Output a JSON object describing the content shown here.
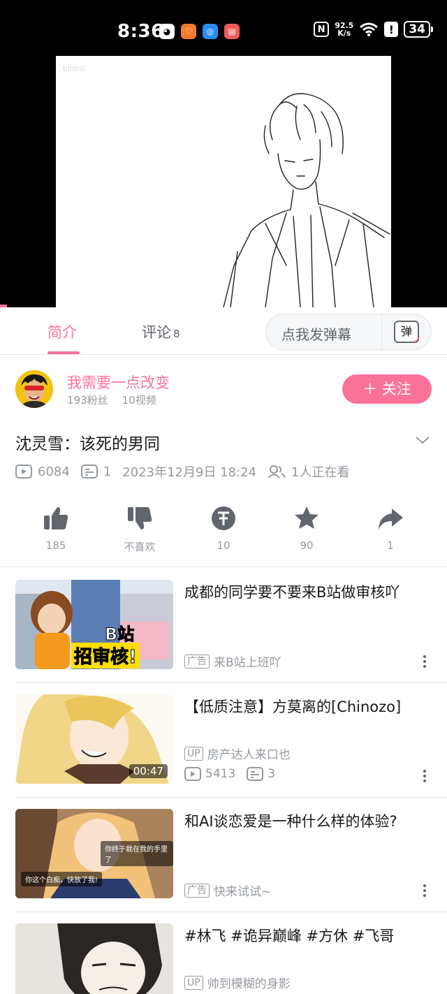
{
  "status_bar": {
    "time": "8:36",
    "net_speed_value": "92.5",
    "net_speed_unit": "K/s",
    "battery": "34",
    "nfc_label": "N",
    "alert_label": "!"
  },
  "video": {
    "watermark": "bilibili"
  },
  "tabs": [
    {
      "label": "简介",
      "active": true
    },
    {
      "label": "评论",
      "count": "8",
      "active": false
    }
  ],
  "danmaku": {
    "placeholder": "点我发弹幕",
    "button_label": "弹"
  },
  "uploader": {
    "name": "我需要一点改变",
    "fans": "193粉丝",
    "videos": "10视频",
    "follow_label": "＋ 关注"
  },
  "video_info": {
    "title": "沈灵雪：该死的男同",
    "views": "6084",
    "danmaku_count": "1",
    "date": "2023年12月9日 18:24",
    "watching": "1人正在看"
  },
  "actions": [
    {
      "icon": "thumb-up-icon",
      "label": "185"
    },
    {
      "icon": "thumb-down-icon",
      "label": "不喜欢"
    },
    {
      "icon": "coin-icon",
      "label": "10"
    },
    {
      "icon": "star-icon",
      "label": "90"
    },
    {
      "icon": "share-icon",
      "label": "1"
    }
  ],
  "recommendations": [
    {
      "title": "成都的同学要不要来B站做审核吖",
      "tag": "广告",
      "author": "来B站上班吖",
      "thumb_text_1": "B站",
      "thumb_text_2": "招审核!"
    },
    {
      "title": "【低质注意】方莫离的[Chinozo]",
      "tag": "UP",
      "author": "房产达人来口也",
      "duration": "00:47",
      "views": "5413",
      "danmaku": "3"
    },
    {
      "title": "和AI谈恋爱是一种什么样的体验?",
      "tag": "广告",
      "author": "快来试试~",
      "thumb_text_1": "你终于栽在我的手里了",
      "thumb_text_2": "你这个白痴，快放了我!"
    },
    {
      "title": "#林飞 #诡异巅峰 #方休 #飞哥",
      "tag": "UP",
      "author": "帅到模糊的身影"
    }
  ],
  "colors": {
    "accent": "#fb7299",
    "text_secondary": "#9499a0"
  }
}
